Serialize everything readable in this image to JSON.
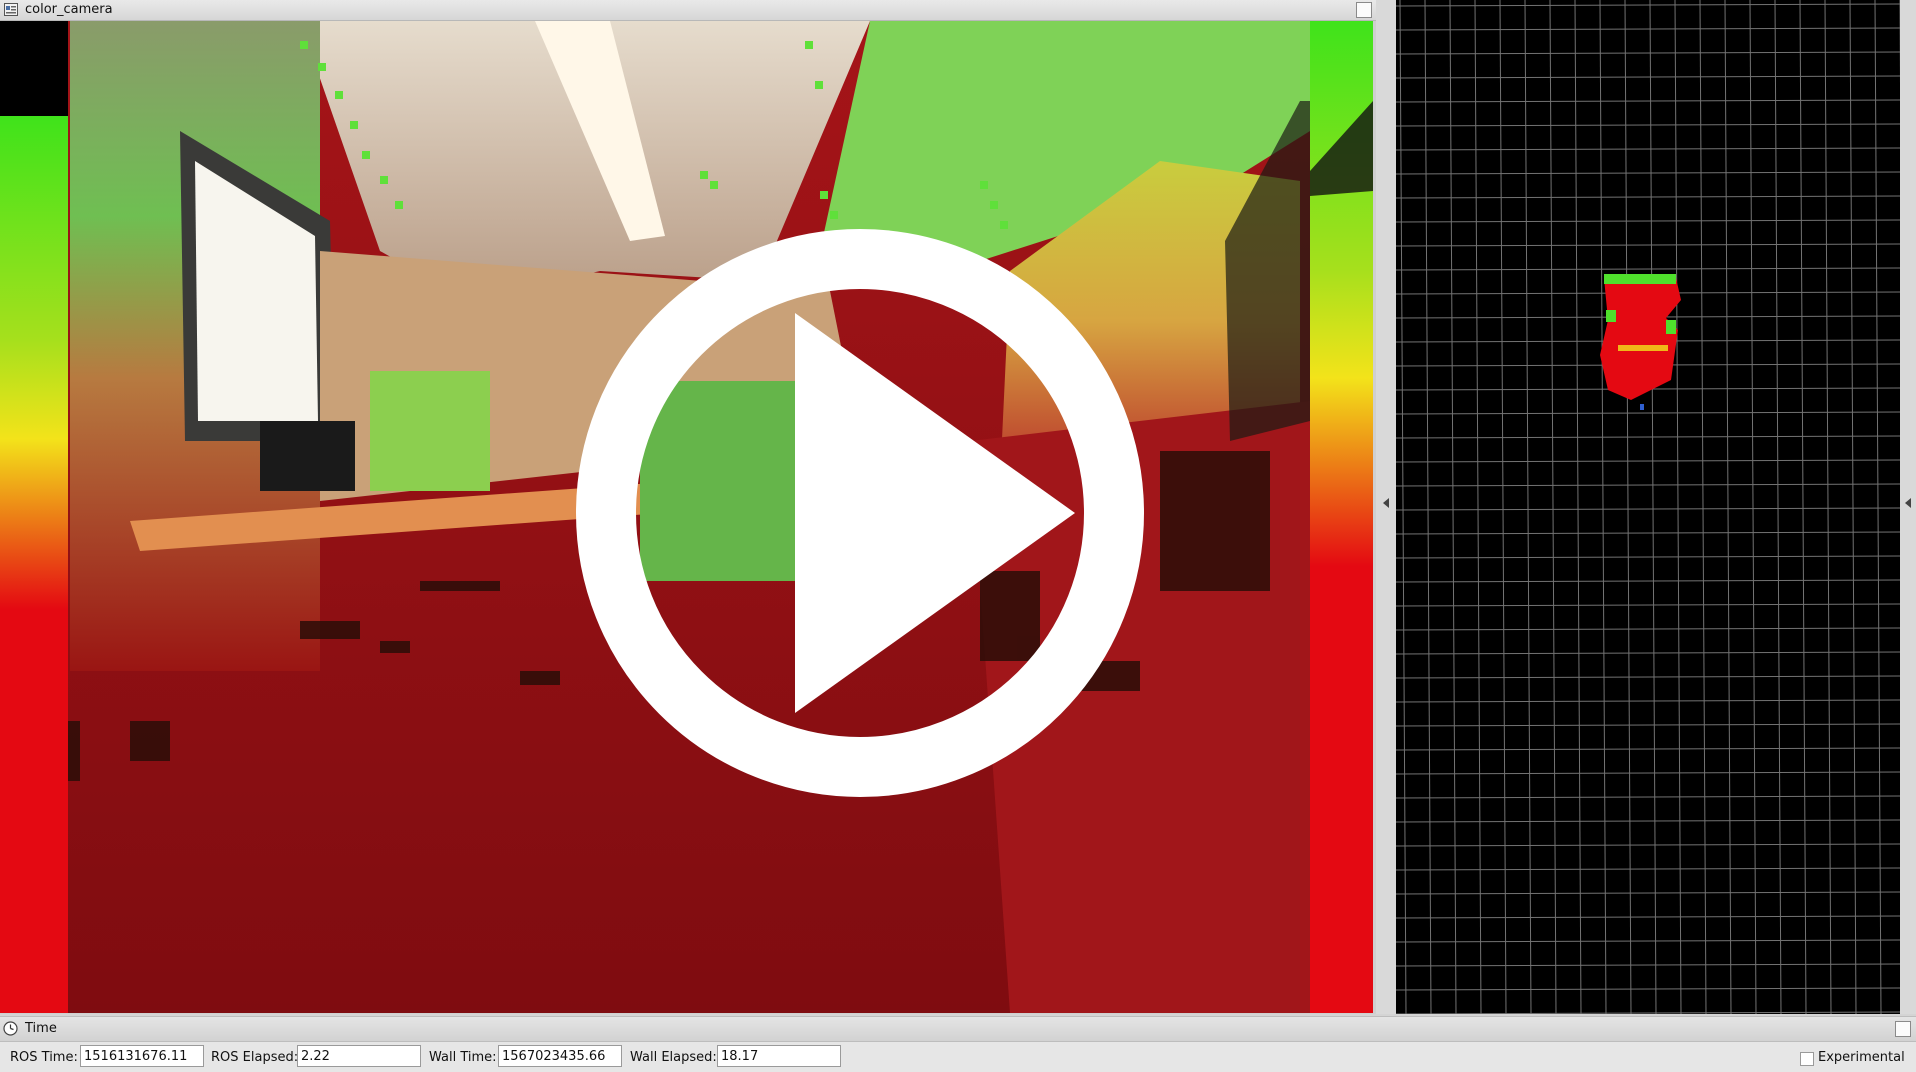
{
  "camera_panel": {
    "title": "color_camera"
  },
  "time_panel": {
    "title": "Time",
    "fields": [
      {
        "label": "ROS Time:",
        "value": "1516131676.11"
      },
      {
        "label": "ROS Elapsed:",
        "value": "2.22"
      },
      {
        "label": "Wall Time:",
        "value": "1567023435.66"
      },
      {
        "label": "Wall Elapsed:",
        "value": "18.17"
      }
    ],
    "experimental_label": "Experimental",
    "experimental_checked": false
  },
  "overlay": {
    "icon": "play-icon"
  },
  "colors": {
    "depth_near": "#e40912",
    "depth_mid": "#f3e31a",
    "depth_far": "#3fe31b",
    "grid_line": "#9a9a9a",
    "map_background": "#000000"
  }
}
